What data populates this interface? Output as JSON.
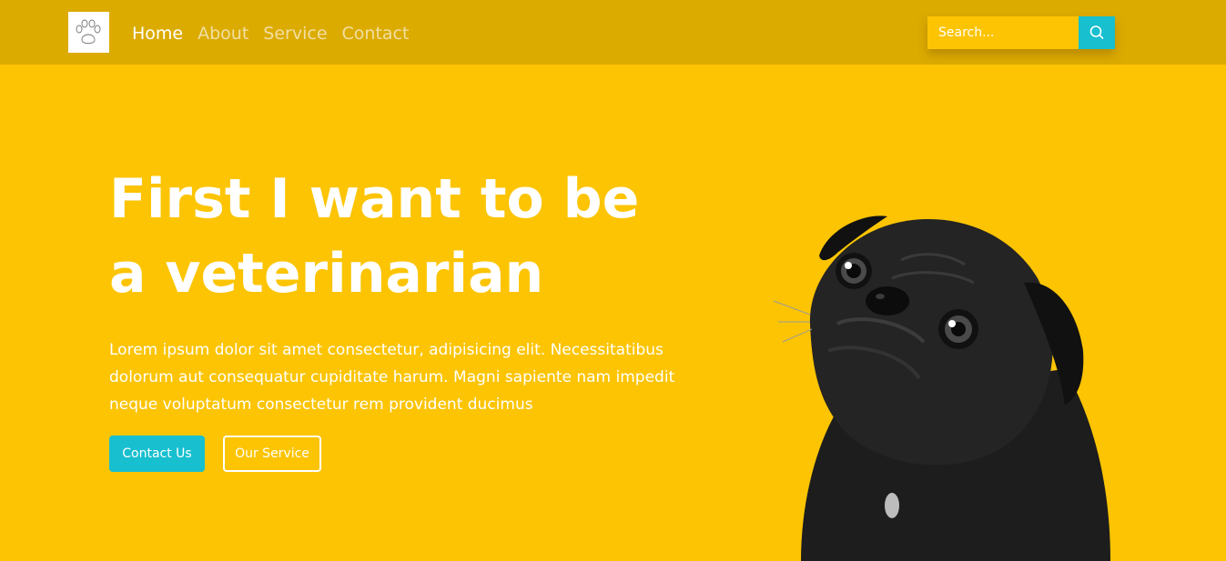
{
  "nav": {
    "links": [
      {
        "label": "Home"
      },
      {
        "label": "About"
      },
      {
        "label": "Service"
      },
      {
        "label": "Contact"
      }
    ],
    "search_placeholder": "Search...",
    "logo_icon": "paw-icon",
    "search_icon": "search-icon"
  },
  "hero": {
    "title_line1": "First I want to be",
    "title_line2": "a veterinarian",
    "text": "Lorem ipsum dolor sit amet consectetur, adipisicing elit. Necessitatibus dolorum aut consequatur cupiditate harum. Magni sapiente nam impedit neque voluptatum consectetur rem provident ducimus",
    "primary_button": "Contact Us",
    "secondary_button": "Our Service"
  },
  "colors": {
    "background": "#fcc402",
    "navbar": "#dcab00",
    "accent": "#17bfcf",
    "text": "#ffffff"
  }
}
